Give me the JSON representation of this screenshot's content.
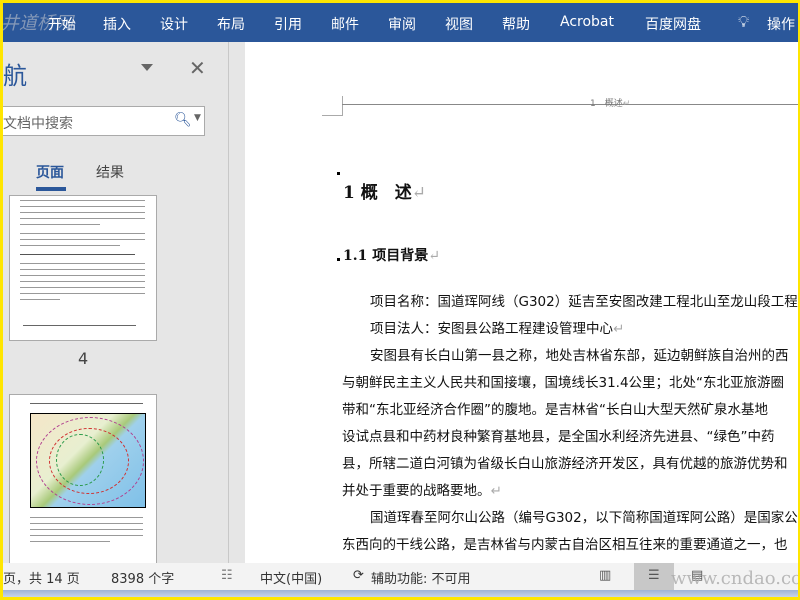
{
  "ribbon": {
    "tabs": [
      "开始",
      "插入",
      "设计",
      "布局",
      "引用",
      "邮件",
      "审阅",
      "视图",
      "帮助",
      "Acrobat",
      "百度网盘"
    ],
    "tell_me": "操作",
    "tell_me_icon": "lightbulb-icon",
    "bg_color": "#2b579a"
  },
  "watermarks": {
    "top_left": "井道桥网",
    "bottom_right": "www.cndao.com"
  },
  "nav": {
    "title": "航",
    "search_placeholder": "文档中搜索",
    "tabs": [
      "页面",
      "结果"
    ],
    "thumb_page_label": "4"
  },
  "doc": {
    "header": "1　概述",
    "h1": "1 概　述",
    "h2": "1.1 项目背景",
    "paragraphs": [
      {
        "text": "项目名称：国道珲阿线（G302）延吉至安图改建工程北山至龙山段工程",
        "indent": true
      },
      {
        "text": "项目法人：安图县公路工程建设管理中心",
        "indent": true,
        "mark": true
      },
      {
        "text": "安图县有长白山第一县之称，地处吉林省东部，延边朝鲜族自治州的西",
        "indent": true
      },
      {
        "text": "与朝鲜民主主义人民共和国接壤，国境线长31.4公里；北处“东北亚旅游圈",
        "indent": false
      },
      {
        "text": "带和“东北亚经济合作圈”的腹地。是吉林省“长白山大型天然矿泉水基地",
        "indent": false
      },
      {
        "text": "设试点县和中药材良种繁育基地县，是全国水利经济先进县、“绿色”中药",
        "indent": false
      },
      {
        "text": "县，所辖二道白河镇为省级长白山旅游经济开发区，具有优越的旅游优势和",
        "indent": false
      },
      {
        "text": "并处于重要的战略要地。",
        "indent": false,
        "mark": true
      },
      {
        "text": "国道珲春至阿尔山公路（编号G302，以下简称国道珲阿公路）是国家公",
        "indent": true
      },
      {
        "text": "东西向的干线公路，是吉林省与内蒙古自治区相互往来的重要通道之一，也",
        "indent": false
      }
    ]
  },
  "status": {
    "page": "页，共 14 页",
    "words": "8398 个字",
    "language": "中文(中国)",
    "accessibility": "辅助功能: 不可用"
  }
}
